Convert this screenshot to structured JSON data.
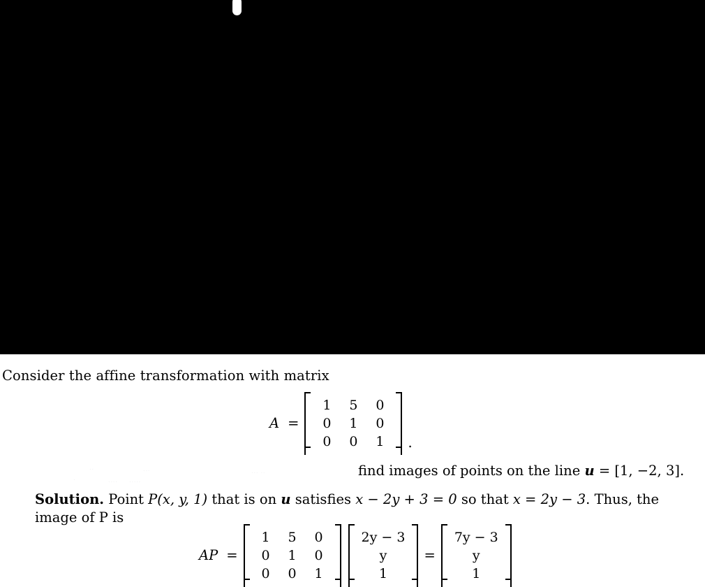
{
  "viewer": {
    "blank_area_color": "#000000",
    "page_background": "#ffffff",
    "loading_indicator": "loading-pill"
  },
  "document": {
    "intro_line": "Consider the affine transformation with matrix",
    "equation_matrix_a": {
      "lhs": "A",
      "relation": "=",
      "matrix": {
        "rows": 3,
        "cols": 3,
        "values": [
          [
            "1",
            "5",
            "0"
          ],
          [
            "0",
            "1",
            "0"
          ],
          [
            "0",
            "0",
            "1"
          ]
        ]
      },
      "trailing": "."
    },
    "find_images_line": {
      "prefix": "find images of points on the line ",
      "vector_symbol": "u",
      "relation": " = ",
      "vector_value": "[1, −2, 3]",
      "trailing": "."
    },
    "solution": {
      "label": "Solution.",
      "line1_part1": " Point ",
      "point_expr": "P(x, y, 1)",
      "line1_part2": " that is on ",
      "vector_symbol": "u",
      "line1_part3": " satisfies ",
      "constraint": "x − 2y + 3 = 0",
      "line1_part4": " so that ",
      "solved": "x = 2y − 3",
      "line1_part5": ". Thus, the",
      "line2": "image of P is"
    },
    "equation_ap": {
      "lhs": "AP",
      "relation1": "=",
      "matrix_a": {
        "rows": 3,
        "cols": 3,
        "values": [
          [
            "1",
            "5",
            "0"
          ],
          [
            "0",
            "1",
            "0"
          ],
          [
            "0",
            "0",
            "1"
          ]
        ]
      },
      "vector_p": {
        "rows": 3,
        "cols": 1,
        "values": [
          [
            "2y − 3"
          ],
          [
            "y"
          ],
          [
            "1"
          ]
        ]
      },
      "relation2": "=",
      "vector_result": {
        "rows": 3,
        "cols": 1,
        "values": [
          [
            "7y − 3"
          ],
          [
            "y"
          ],
          [
            "1"
          ]
        ]
      }
    }
  },
  "artifacts": {
    "ghost_1": "..",
    "ghost_2": "...",
    "ghost_3": "... ..",
    "ghost_4": ".",
    "ghost_5": "....",
    "ghost_6": "....."
  }
}
